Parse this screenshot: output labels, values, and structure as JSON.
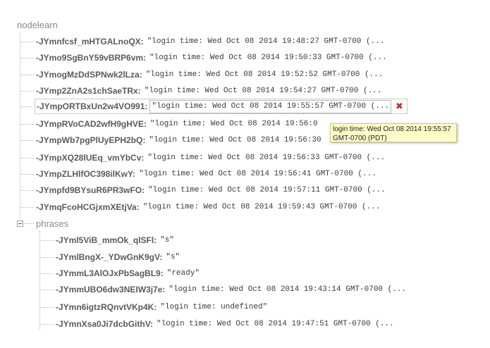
{
  "root": {
    "label": "nodelearn"
  },
  "children": [
    {
      "key": "-JYmnfcsf_mHTGALnoQX:",
      "value": "\"login time: Wed Oct 08 2014 19:48:27 GMT-0700 (..."
    },
    {
      "key": "-JYmo9SgBnY59vBRP6vm:",
      "value": "\"login time: Wed Oct 08 2014 19:50:33 GMT-0700 (..."
    },
    {
      "key": "-JYmogMzDdSPNwk2lLza:",
      "value": "\"login time: Wed Oct 08 2014 19:52:52 GMT-0700 (..."
    },
    {
      "key": "-JYmp2ZnA2s1chSaeTRx:",
      "value": "\"login time: Wed Oct 08 2014 19:54:27 GMT-0700 (..."
    },
    {
      "key": "-JYmpORTBxUn2w4VO991:",
      "value": "\"login time: Wed Oct 08 2014 19:55:57 GMT-0700 (..."
    },
    {
      "key": "-JYmpRVoCAD2wfH9gHVE:",
      "value": "\"login time: Wed Oct 08 2014 19:56:0"
    },
    {
      "key": "-JYmpWb7pgPlUyEPH2bQ:",
      "value": "\"login time: Wed Oct 08 2014 19:56:30"
    },
    {
      "key": "-JYmpXQ28lUEq_vmYbCv:",
      "value": "\"login time: Wed Oct 08 2014 19:56:33 GMT-0700 (..."
    },
    {
      "key": "-JYmpZLHlfOC398ilKwY:",
      "value": "\"login time: Wed Oct 08 2014 19:56:41 GMT-0700 (..."
    },
    {
      "key": "-JYmpfd9BYsuR6PR3wFO:",
      "value": "\"login time: Wed Oct 08 2014 19:57:11 GMT-0700 (..."
    },
    {
      "key": "-JYmqFcoHCGjxmXEtjVa:",
      "value": "\"login time: Wed Oct 08 2014 19:59:43 GMT-0700 (..."
    }
  ],
  "editing": {
    "delete_glyph": "✖",
    "tooltip": "login time: Wed Oct 08 2014 19:55:57 GMT-0700 (PDT)"
  },
  "phrases": {
    "label": "phrases",
    "children": [
      {
        "key": "-JYml5ViB_mmOk_qlSFl:",
        "value": "\"s\""
      },
      {
        "key": "-JYmlBngX-_YDwGnK9gV:",
        "value": "\"s\""
      },
      {
        "key": "-JYmmL3AlOJxPbSagBL9:",
        "value": "\"ready\""
      },
      {
        "key": "-JYmmUBO6dw3NEIW3j7e:",
        "value": "\"login time: Wed Oct 08 2014 19:43:14 GMT-0700 (..."
      },
      {
        "key": "-JYmn6igtzRQnvtVKp4K:",
        "value": "\"login time: undefined\""
      },
      {
        "key": "-JYmnXsa0Ji7dcbGithV:",
        "value": "\"login time: Wed Oct 08 2014 19:47:51 GMT-0700 (..."
      }
    ]
  }
}
